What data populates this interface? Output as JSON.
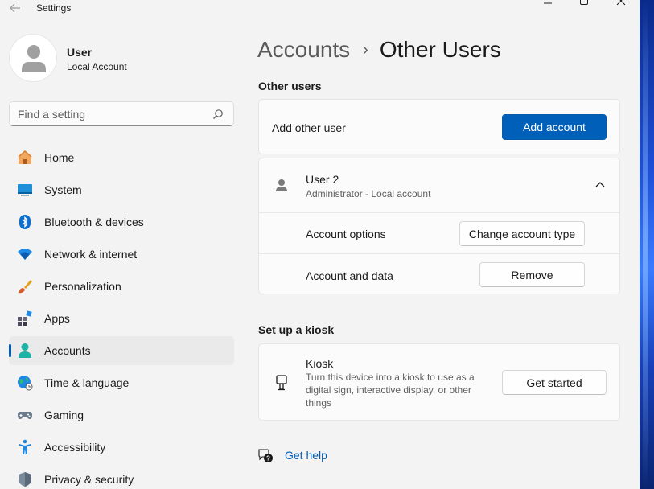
{
  "window": {
    "title": "Settings",
    "back": "←"
  },
  "profile": {
    "name": "User",
    "subtitle": "Local Account"
  },
  "search": {
    "placeholder": "Find a setting"
  },
  "nav": {
    "items": [
      {
        "label": "Home",
        "icon": "home-icon"
      },
      {
        "label": "System",
        "icon": "system-icon"
      },
      {
        "label": "Bluetooth & devices",
        "icon": "bluetooth-icon"
      },
      {
        "label": "Network & internet",
        "icon": "wifi-icon"
      },
      {
        "label": "Personalization",
        "icon": "brush-icon"
      },
      {
        "label": "Apps",
        "icon": "apps-icon"
      },
      {
        "label": "Accounts",
        "icon": "accounts-icon",
        "active": true
      },
      {
        "label": "Time & language",
        "icon": "globe-icon"
      },
      {
        "label": "Gaming",
        "icon": "gamepad-icon"
      },
      {
        "label": "Accessibility",
        "icon": "accessibility-icon"
      },
      {
        "label": "Privacy & security",
        "icon": "shield-icon"
      }
    ]
  },
  "breadcrumb": {
    "parent": "Accounts",
    "separator": "›",
    "current": "Other Users"
  },
  "other_users": {
    "section_title": "Other users",
    "add_label": "Add other user",
    "add_button": "Add account",
    "user": {
      "name": "User 2",
      "detail": "Administrator - Local account",
      "options_label": "Account options",
      "options_button": "Change account type",
      "data_label": "Account and data",
      "data_button": "Remove"
    }
  },
  "kiosk": {
    "section_title": "Set up a kiosk",
    "title": "Kiosk",
    "description_line1": "Turn this device into a kiosk to use as a",
    "description_line2": "digital sign, interactive display, or other",
    "description_line3": "things",
    "button": "Get started"
  },
  "help": {
    "label": "Get help"
  },
  "colors": {
    "accent": "#005fb8",
    "background": "#f3f3f3",
    "card": "#fbfbfb"
  }
}
